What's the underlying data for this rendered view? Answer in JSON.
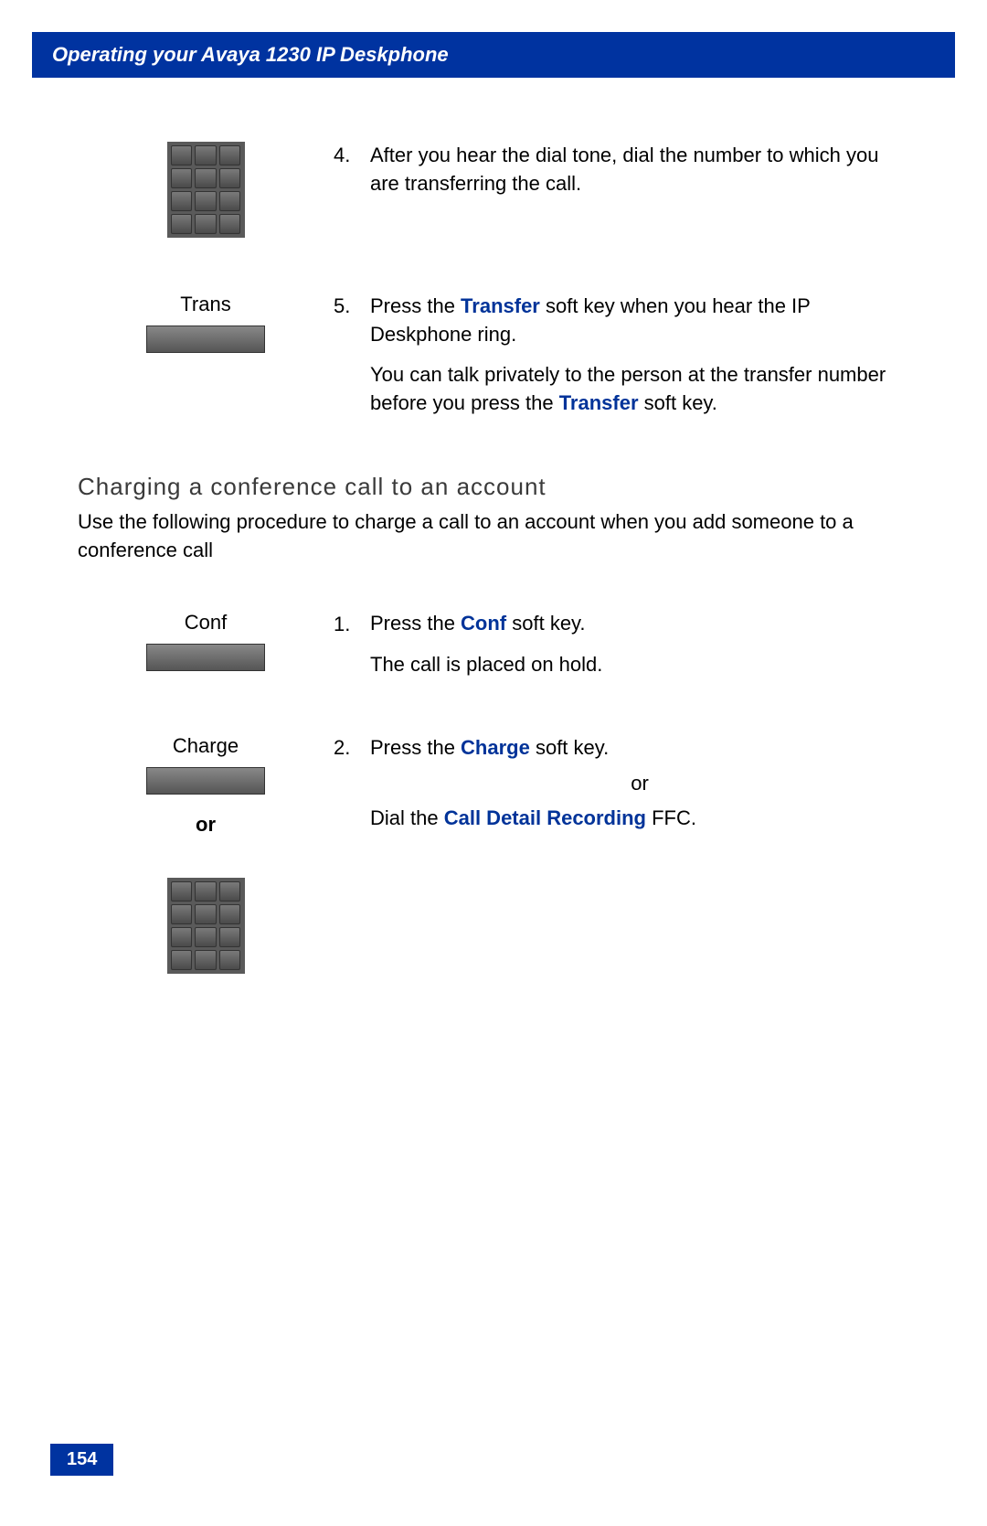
{
  "header": {
    "title": "Operating your Avaya 1230 IP Deskphone"
  },
  "steps_top": {
    "step4": {
      "number": "4.",
      "text": "After you hear the dial tone, dial the number to which you are transferring the call."
    },
    "step5": {
      "label": "Trans",
      "number": "5.",
      "text_a": "Press the ",
      "text_b": "Transfer",
      "text_c": " soft key when you hear the IP Deskphone ring.",
      "para_a": "You can talk privately to the person at the transfer number before you press the ",
      "para_b": "Transfer",
      "para_c": " soft key."
    }
  },
  "section": {
    "heading": "Charging a conference call to an account",
    "intro": "Use the following procedure to charge a call to an account when you add someone to a conference call"
  },
  "steps_bottom": {
    "step1": {
      "label": "Conf",
      "number": "1.",
      "text_a": "Press the ",
      "text_b": "Conf",
      "text_c": " soft key.",
      "para": "The call is placed on hold."
    },
    "step2": {
      "label": "Charge",
      "or_label": "or",
      "number": "2.",
      "text_a": "Press the ",
      "text_b": "Charge",
      "text_c": " soft key.",
      "or_text": "or",
      "para_a": "Dial the ",
      "para_b": "Call Detail Recording",
      "para_c": " FFC."
    }
  },
  "page_number": "154"
}
